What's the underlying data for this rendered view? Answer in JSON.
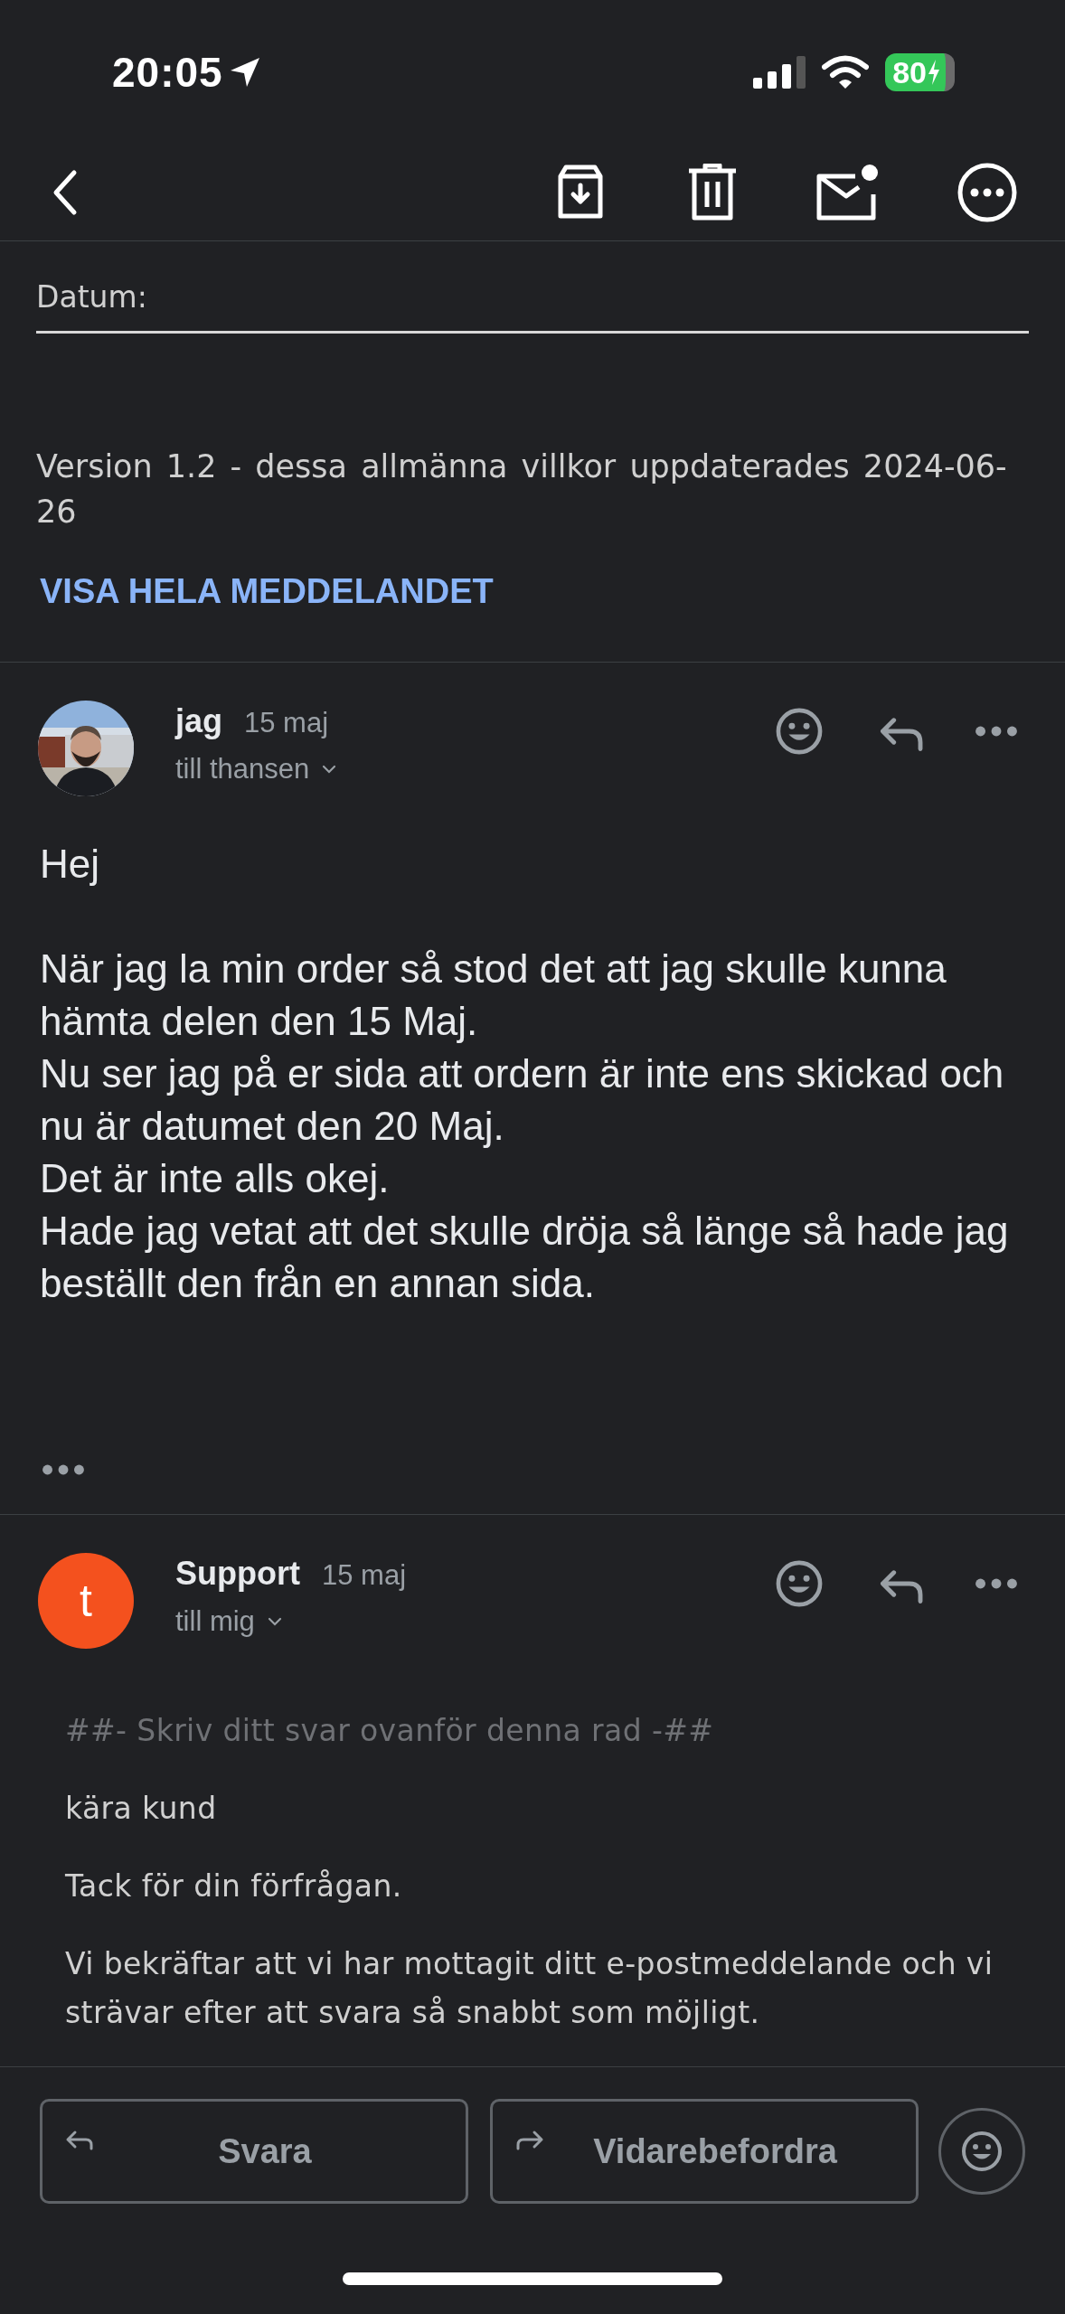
{
  "status_bar": {
    "time": "20:05",
    "battery": "80"
  },
  "quoted": {
    "label": "Datum:",
    "version": "Version 1.2 - dessa allmänna villkor uppdaterades 2024-06-26",
    "show_full_link": "VISA HELA MEDDELANDET"
  },
  "messages": [
    {
      "sender": "jag",
      "date": "15 maj",
      "recipient": "till thansen",
      "avatar": {
        "kind": "picture"
      },
      "kind": "plain",
      "trimmed": true,
      "blocks": [
        [
          "Hej"
        ],
        [
          "När jag la min order så stod det att jag skulle kunna hämta delen den 15 Maj.",
          "Nu ser jag på er sida att ordern är inte ens skickad och nu är datumet den 20 Maj.",
          "Det är inte alls okej.",
          "Hade jag vetat att det skulle dröja så länge så hade jag beställt den från en annan sida."
        ]
      ]
    },
    {
      "sender": "Support",
      "date": "15 maj",
      "recipient": "till mig",
      "avatar": {
        "kind": "letter",
        "letter": "t",
        "color": "#f4511e"
      },
      "kind": "html",
      "trimmed": false,
      "blocks": [
        [
          "##- Skriv ditt svar ovanför denna rad -##"
        ],
        [
          "kära kund"
        ],
        [
          "Tack för din förfrågan."
        ],
        [
          "Vi bekräftar att vi har mottagit ditt e-postmeddelande och vi strävar efter att svara så snabbt som möjligt."
        ]
      ]
    }
  ],
  "actions": [
    {
      "kind": "reply",
      "label": "Svara"
    },
    {
      "kind": "forward",
      "label": "Vidarebefordra"
    }
  ]
}
